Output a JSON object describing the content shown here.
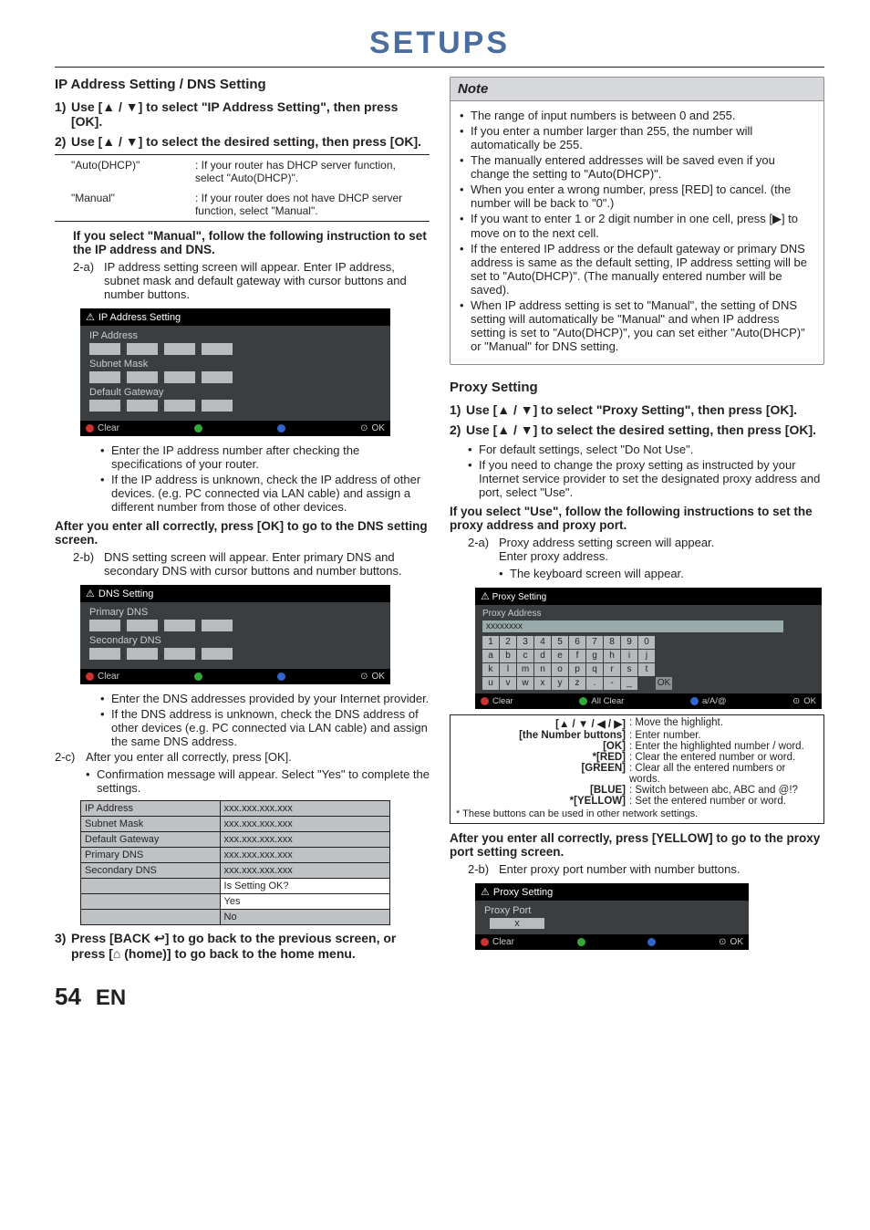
{
  "page": {
    "title": "SETUPS",
    "number": "54",
    "lang": "EN"
  },
  "left": {
    "section_title": "IP Address Setting / DNS Setting",
    "step1": "Use [▲ / ▼] to select \"IP Address Setting\", then press [OK].",
    "step2": "Use [▲ / ▼] to select the desired setting, then press [OK].",
    "options": [
      {
        "name": "\"Auto(DHCP)\"",
        "desc": ": If your router has DHCP server function, select \"Auto(DHCP)\"."
      },
      {
        "name": "\"Manual\"",
        "desc": ": If your router does not have DHCP server function, select \"Manual\"."
      }
    ],
    "manual_head": "If you select \"Manual\", follow the following instruction to set the IP address and DNS.",
    "sub2a": {
      "num": "2-a)",
      "text": "IP address setting screen will appear. Enter IP address, subnet mask and default gateway with cursor buttons and number buttons."
    },
    "ip_screen": {
      "title": "IP Address Setting",
      "fields": [
        "IP Address",
        "Subnet Mask",
        "Default Gateway"
      ],
      "foot_clear": "Clear",
      "foot_ok": "OK"
    },
    "ip_bullets": [
      "Enter the IP address number after checking the specifications of your router.",
      "If the IP address is unknown, check the IP address of other devices. (e.g. PC connected via LAN cable) and assign a different number from those of other devices."
    ],
    "after_ip": "After you enter all correctly, press [OK] to go to the DNS setting screen.",
    "sub2b": {
      "num": "2-b)",
      "text": "DNS setting screen will appear. Enter primary DNS and secondary DNS with cursor buttons and number buttons."
    },
    "dns_screen": {
      "title": "DNS Setting",
      "fields": [
        "Primary DNS",
        "Secondary DNS"
      ],
      "foot_clear": "Clear",
      "foot_ok": "OK"
    },
    "dns_bullets": [
      "Enter the DNS addresses provided by your Internet provider.",
      "If the DNS address is unknown, check the DNS address of other devices (e.g. PC connected via LAN cable) and assign the same DNS address."
    ],
    "sub2c": {
      "num": "2-c)",
      "text": "After you enter all correctly, press [OK]."
    },
    "sub2c_bul": "Confirmation message will appear. Select \"Yes\" to complete the settings.",
    "confirm_rows": [
      [
        "IP Address",
        "xxx.xxx.xxx.xxx"
      ],
      [
        "Subnet Mask",
        "xxx.xxx.xxx.xxx"
      ],
      [
        "Default Gateway",
        "xxx.xxx.xxx.xxx"
      ],
      [
        "Primary DNS",
        "xxx.xxx.xxx.xxx"
      ],
      [
        "Secondary DNS",
        "xxx.xxx.xxx.xxx"
      ]
    ],
    "confirm_msg": "Is Setting OK?",
    "confirm_yes": "Yes",
    "confirm_no": "No",
    "step3": "Press [BACK ↩] to go back to the previous screen, or press [⌂ (home)] to go back to the home menu."
  },
  "right": {
    "note_title": "Note",
    "notes": [
      "The range of input numbers is between 0 and 255.",
      "If you enter a number larger than 255, the number will automatically be 255.",
      "The manually entered addresses will be saved even if you change the setting to \"Auto(DHCP)\".",
      "When you enter a wrong number, press [RED] to cancel. (the number will be back to \"0\".)",
      "If you want to enter 1 or 2 digit number in one cell, press [▶] to move on to the next cell.",
      "If the entered IP address or the default gateway or primary DNS address is same as the default setting, IP address setting will be set to \"Auto(DHCP)\". (The manually entered number will be saved).",
      "When IP address setting is set to \"Manual\", the setting of DNS setting will automatically be \"Manual\" and when IP address setting is set to \"Auto(DHCP)\", you can set either \"Auto(DHCP)\" or \"Manual\" for DNS setting."
    ],
    "proxy_title": "Proxy Setting",
    "pstep1": "Use [▲ / ▼] to select \"Proxy Setting\", then press [OK].",
    "pstep2": "Use [▲ / ▼] to select the desired setting, then press [OK].",
    "pbul": [
      "For default settings, select \"Do Not Use\".",
      "If you need to change the proxy setting as instructed by your Internet service provider to set the designated proxy address and port, select \"Use\"."
    ],
    "use_head": "If you select \"Use\", follow the following instructions to set the proxy address and proxy port.",
    "p2a": {
      "num": "2-a)",
      "text": "Proxy address setting screen will appear.",
      "l2": "Enter proxy address.",
      "l3": "The keyboard screen will appear."
    },
    "proxy_kb": {
      "title": "Proxy Setting",
      "addr_label": "Proxy Address",
      "addr_val": "xxxxxxxx",
      "rows": [
        [
          "1",
          "2",
          "3",
          "4",
          "5",
          "6",
          "7",
          "8",
          "9",
          "0",
          ""
        ],
        [
          "a",
          "b",
          "c",
          "d",
          "e",
          "f",
          "g",
          "h",
          "i",
          "j",
          ""
        ],
        [
          "k",
          "l",
          "m",
          "n",
          "o",
          "p",
          "q",
          "r",
          "s",
          "t",
          ""
        ],
        [
          "u",
          "v",
          "w",
          "x",
          "y",
          "z",
          ".",
          "-",
          "_",
          "",
          "OK"
        ]
      ],
      "foot": {
        "clear": "Clear",
        "all": "All Clear",
        "mode": "a/A/@",
        "ok": "OK"
      }
    },
    "legend": [
      {
        "k": "[▲ / ▼ / ◀ / ▶]",
        "v": ": Move the highlight."
      },
      {
        "k": "[the Number buttons]",
        "v": ": Enter number."
      },
      {
        "k": "[OK]",
        "v": ": Enter the highlighted number / word."
      },
      {
        "k": "*[RED]",
        "v": ": Clear the entered number or word."
      },
      {
        "k": "[GREEN]",
        "v": ": Clear all the entered numbers or words."
      },
      {
        "k": "[BLUE]",
        "v": ": Switch between abc, ABC and @!?"
      },
      {
        "k": "*[YELLOW]",
        "v": ": Set the entered number or word."
      }
    ],
    "legend_note": "* These buttons can be used in other network settings.",
    "after_proxy": "After you enter all correctly, press [YELLOW] to go to the proxy port setting screen.",
    "p2b": {
      "num": "2-b)",
      "text": "Enter proxy port number with number buttons."
    },
    "pp_screen": {
      "title": "Proxy Setting",
      "label": "Proxy Port",
      "val": "x",
      "clear": "Clear",
      "ok": "OK"
    }
  }
}
